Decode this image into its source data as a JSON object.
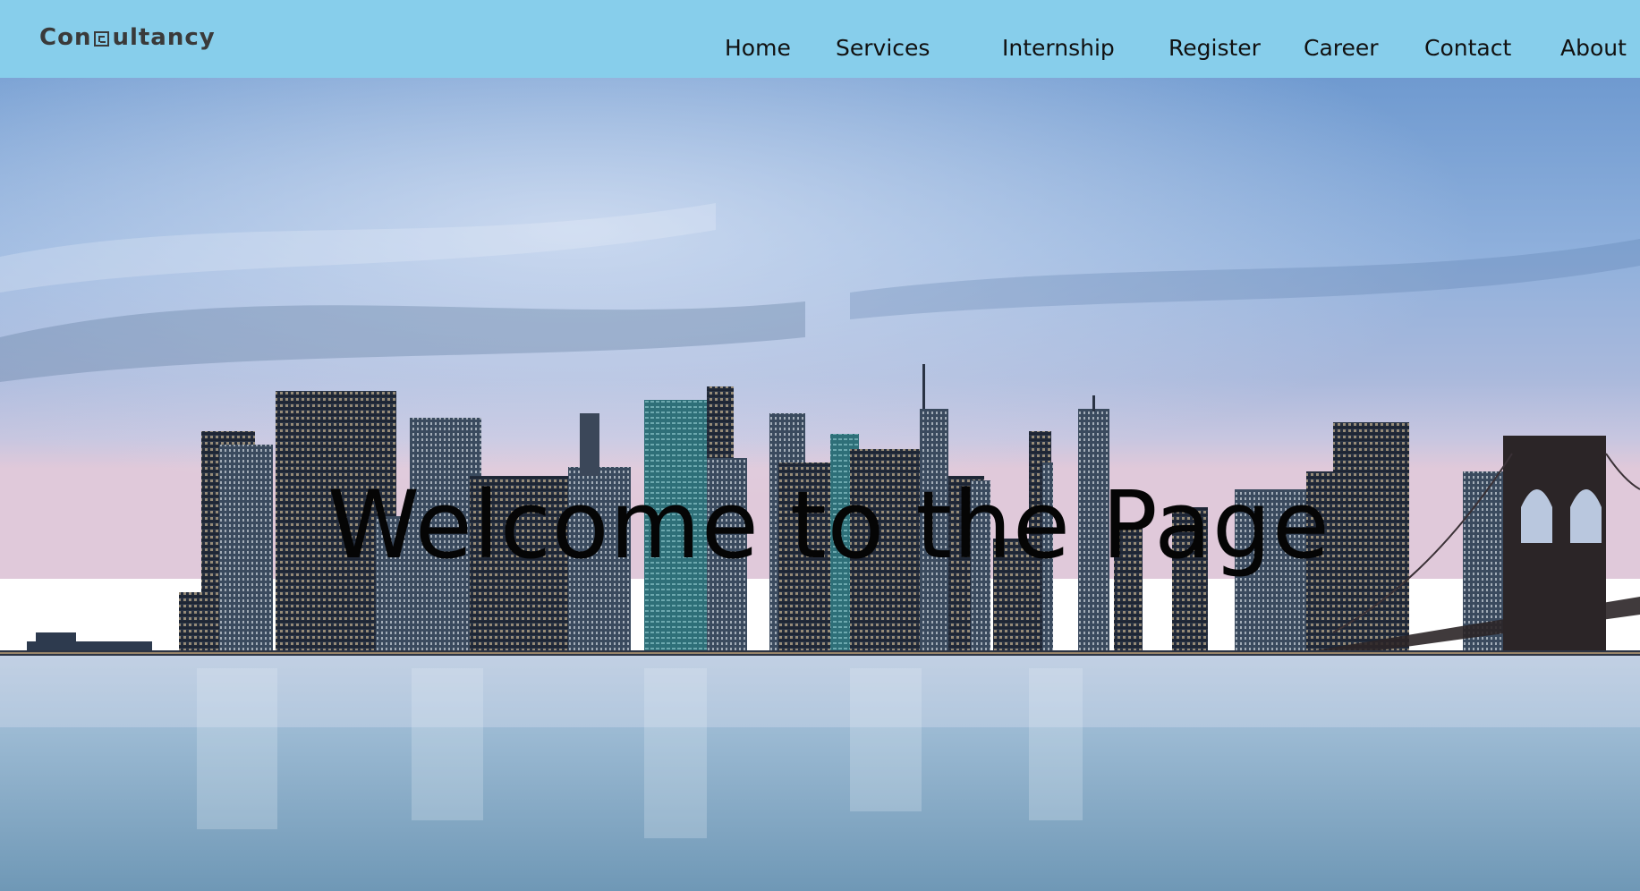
{
  "header": {
    "logo_text_before": "Con",
    "logo_text_after": "ultancy",
    "background": "#87ceeb"
  },
  "nav": {
    "items": [
      {
        "label": "Home"
      },
      {
        "label": "Services"
      },
      {
        "label": "Internship"
      },
      {
        "label": "Register"
      },
      {
        "label": "Career"
      },
      {
        "label": "Contact"
      },
      {
        "label": "About"
      }
    ]
  },
  "hero": {
    "headline": "Welcome to the Page",
    "background_image": "city-skyline-at-dusk-over-water"
  },
  "colors": {
    "header_bg": "#87ceeb",
    "text": "#111111",
    "sky_top": "#5f8fc6",
    "water": "#8fb4cf"
  }
}
